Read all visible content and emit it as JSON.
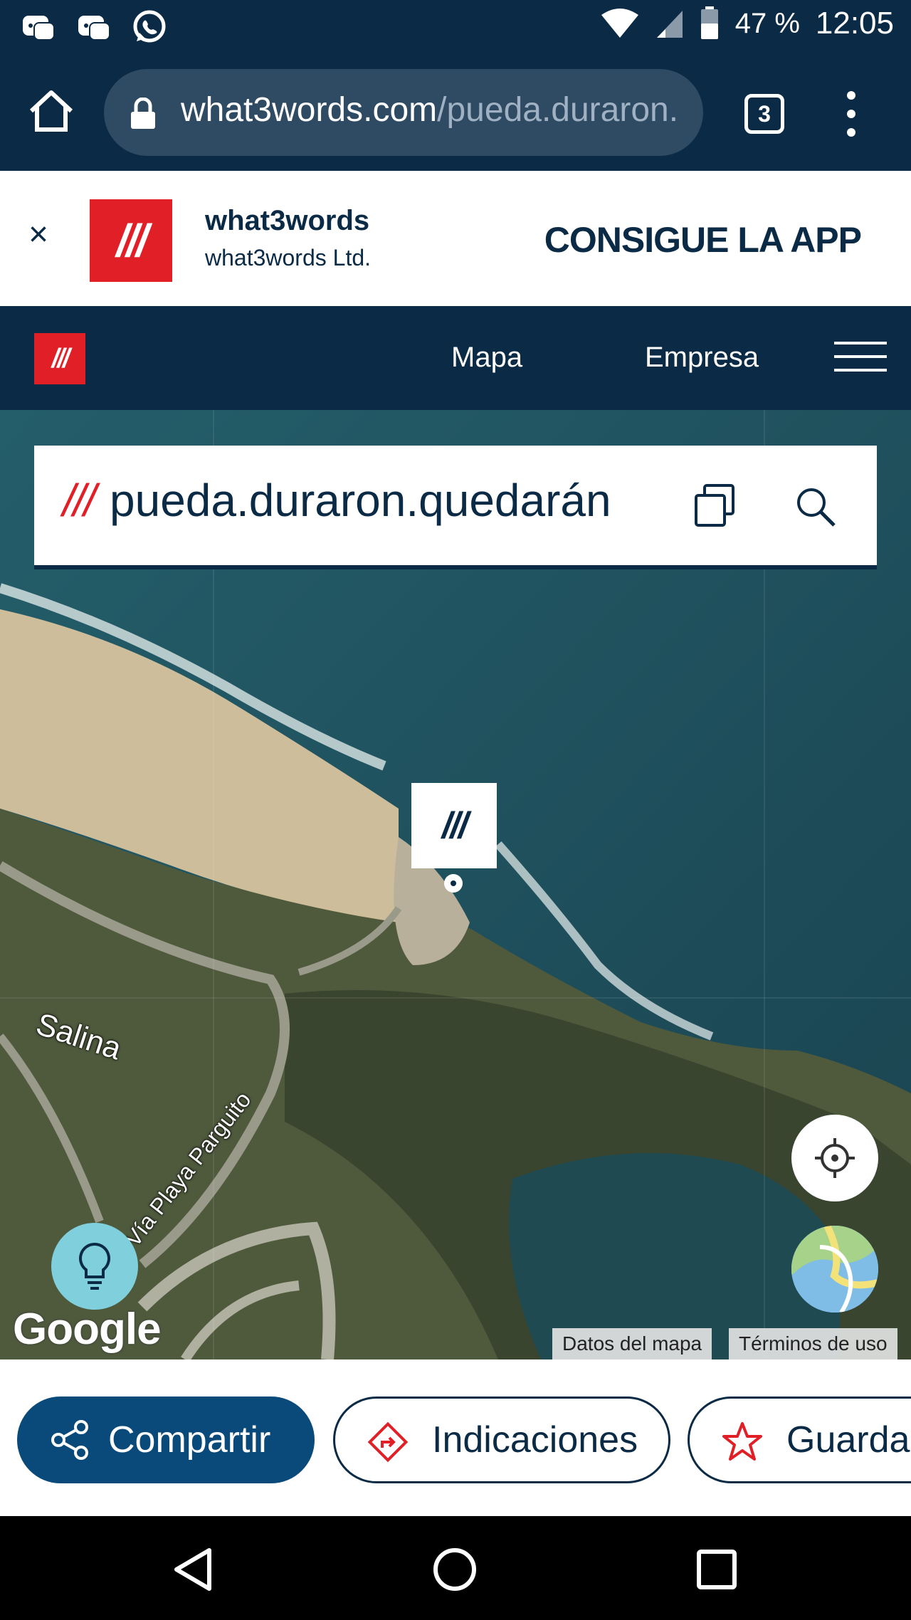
{
  "status_bar": {
    "battery": "47 %",
    "time": "12:05",
    "left_icons": [
      "discord-icon",
      "discord-icon",
      "whatsapp-icon"
    ],
    "right_icons": [
      "wifi-icon",
      "signal-icon",
      "battery-icon"
    ]
  },
  "browser": {
    "url_host": "what3words.com",
    "url_path": "/pueda.duraron.",
    "tab_count": "3"
  },
  "app_banner": {
    "close_label": "×",
    "logo_text": "///",
    "app_name": "what3words",
    "company": "what3words Ltd.",
    "cta": "CONSIGUE LA APP"
  },
  "site_nav": {
    "logo_text": "///",
    "links": [
      "Mapa",
      "Empresa"
    ]
  },
  "search": {
    "prefix": "///",
    "address": "pueda.duraron.quedarán"
  },
  "map": {
    "marker_text": "///",
    "labels": {
      "salina": "Salina",
      "road": "Vía Playa Parguito"
    },
    "google_logo": "Google",
    "attribution": [
      "Datos del mapa",
      "Términos de uso"
    ]
  },
  "actions": {
    "share": "Compartir",
    "directions": "Indicaciones",
    "save": "Guardar"
  },
  "colors": {
    "navy": "#0a2a45",
    "brand_red": "#e11f26",
    "share_blue": "#0a4a7a"
  }
}
